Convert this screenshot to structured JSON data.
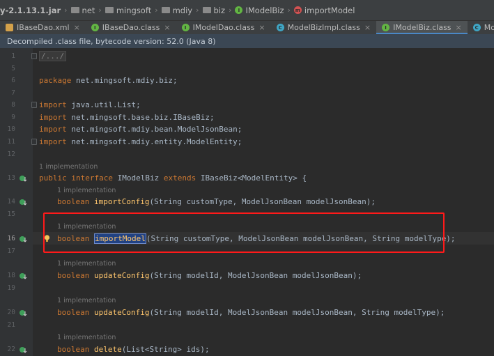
{
  "breadcrumb": {
    "items": [
      "y-2.1.13.1.jar",
      "net",
      "mingsoft",
      "mdiy",
      "biz",
      "IModelBiz",
      "importModel"
    ]
  },
  "tabs": [
    {
      "label": "IBaseDao.xml",
      "icon": "xml-icon",
      "active": false
    },
    {
      "label": "IBaseDao.class",
      "icon": "interface-icon",
      "active": false
    },
    {
      "label": "IModelDao.class",
      "icon": "interface-icon",
      "active": false
    },
    {
      "label": "ModelBizImpl.class",
      "icon": "class-icon",
      "active": false
    },
    {
      "label": "IModelBiz.class",
      "icon": "interface-icon",
      "active": true
    },
    {
      "label": "ModelAction.class",
      "icon": "class-icon",
      "active": false
    }
  ],
  "banner": {
    "text": "Decompiled .class file, bytecode version: 52.0 (Java 8)"
  },
  "editor": {
    "hint_text": "1 implementation",
    "collapsed_comment": "/.../",
    "lines": {
      "l1": "1",
      "l5": "5",
      "l6": "6",
      "l7": "7",
      "l8": "8",
      "l9": "9",
      "l10": "10",
      "l11": "11",
      "l12": "12",
      "l13": "13",
      "l14": "14",
      "l15": "15",
      "l16": "16",
      "l17": "17",
      "l18": "18",
      "l19": "19",
      "l20": "20",
      "l21": "21",
      "l22": "22"
    },
    "package_kw": "package",
    "package_name": " net.mingsoft.mdiy.biz;",
    "import_kw": "import",
    "imports": [
      " java.util.List;",
      " net.mingsoft.base.biz.IBaseBiz;",
      " net.mingsoft.mdiy.bean.ModelJsonBean;",
      " net.mingsoft.mdiy.entity.ModelEntity;"
    ],
    "iface_public": "public",
    "iface_interface": "interface",
    "iface_name": " IModelBiz ",
    "iface_extends": "extends",
    "iface_rest": " IBaseBiz<ModelEntity> {",
    "boolean_kw": "boolean",
    "m_import_config_name": "importConfig",
    "m_import_config_args": "(String customType, ModelJsonBean modelJsonBean);",
    "m_import_model_name": "importModel",
    "m_import_model_args": "(String customType, ModelJsonBean modelJsonBean, String modelType);",
    "m_update_config_name": "updateConfig",
    "m_update_config_args1": "(String modelId, ModelJsonBean modelJsonBean);",
    "m_update_config_args2": "(String modelId, ModelJsonBean modelJsonBean, String modelType);",
    "m_delete_name": "delete",
    "m_delete_args": "(List<String> ids);"
  },
  "colors": {
    "keyword": "#cc7832",
    "method": "#ffc66d",
    "highlight_border": "#ff1a1a",
    "active_tab_underline": "#4a88c7"
  }
}
